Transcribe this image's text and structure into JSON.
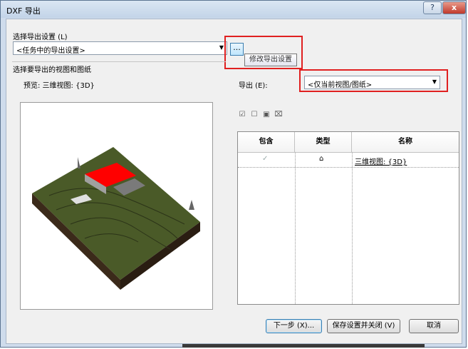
{
  "window": {
    "title": "DXF 导出",
    "help_glyph": "?",
    "close_glyph": "x"
  },
  "settings": {
    "label": "选择导出设置 (L)",
    "selected": "<任务中的导出设置>",
    "ellipsis": "...",
    "tooltip": "修改导出设置"
  },
  "views": {
    "label": "选择要导出的视图和图纸",
    "preview_label": "预览: 三维视图: {3D}",
    "export_label": "导出 (E):",
    "export_selected": "<仅当前视图/图纸>"
  },
  "toolbar_icons": [
    "check-all-icon",
    "uncheck-icon",
    "select-icon",
    "clear-icon"
  ],
  "table": {
    "columns": [
      "包含",
      "类型",
      "名称"
    ],
    "rows": [
      {
        "include": "✓",
        "type_icon": "3d-view-icon",
        "name": "三维视图: {3D}"
      }
    ]
  },
  "buttons": {
    "next": "下一步 (X)...",
    "save_close": "保存设置并关闭 (V)",
    "cancel": "取消"
  },
  "colors": {
    "highlight_box": "#e02020",
    "roof": "#ff0000",
    "terrain": "#4a5a28"
  }
}
